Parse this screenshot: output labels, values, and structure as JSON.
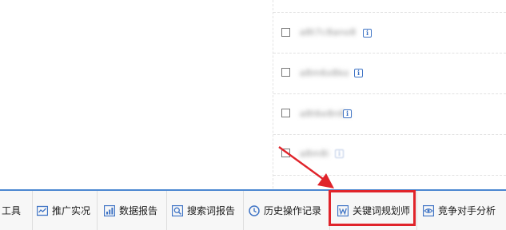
{
  "keywords": [
    {
      "text": "a8t7c8ano8",
      "info_icon": "info-icon"
    },
    {
      "text": "a8m6o8ko",
      "info_icon": "info-icon"
    },
    {
      "text": "a8t6e8n8o",
      "info_icon": "info-icon"
    },
    {
      "text": "a8m8i",
      "info_icon": "info-icon"
    }
  ],
  "toolbar": {
    "items": [
      {
        "label": "工具",
        "icon": "none"
      },
      {
        "label": "推广实况",
        "icon": "line-chart-icon"
      },
      {
        "label": "数据报告",
        "icon": "bar-chart-icon"
      },
      {
        "label": "搜索词报告",
        "icon": "search-report-icon"
      },
      {
        "label": "历史操作记录",
        "icon": "clock-icon"
      },
      {
        "label": "关键词规划师",
        "icon": "w-document-icon"
      },
      {
        "label": "竞争对手分析",
        "icon": "eye-icon"
      }
    ]
  },
  "highlight": {
    "target": "关键词规划师",
    "color": "#e0242b"
  },
  "colors": {
    "accent": "#4b87d1",
    "icon_blue": "#3f74c5",
    "annotation_red": "#e0242b"
  }
}
